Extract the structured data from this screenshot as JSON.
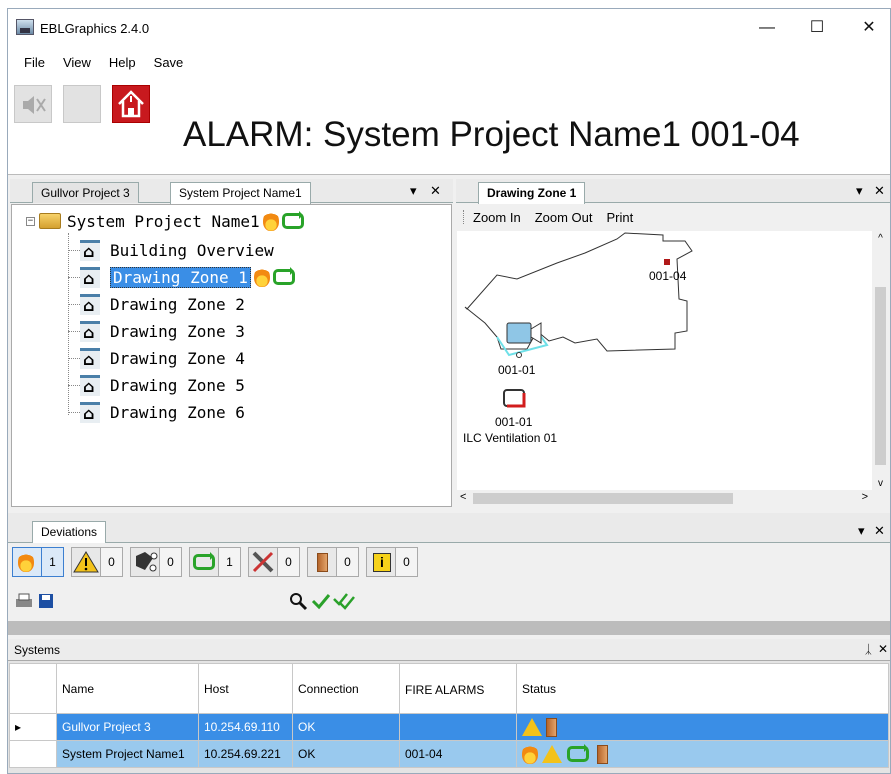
{
  "window": {
    "title": "EBLGraphics 2.4.0",
    "minimize_glyph": "—",
    "maximize_glyph": "☐",
    "close_glyph": "✕"
  },
  "menu": {
    "file": "File",
    "view": "View",
    "help": "Help",
    "save": "Save"
  },
  "alarm_banner": "ALARM: System Project Name1 001-04",
  "left_pane": {
    "tabs": [
      "Gullvor Project 3",
      "System Project Name1"
    ],
    "pin_glyph": "▾",
    "close_glyph": "✕",
    "tree": {
      "root": "System Project Name1",
      "nodes": [
        "Building Overview",
        "Drawing Zone 1",
        "Drawing Zone 2",
        "Drawing Zone 3",
        "Drawing Zone 4",
        "Drawing Zone 5",
        "Drawing Zone 6"
      ],
      "selected_node": "Drawing Zone 1"
    }
  },
  "right_pane": {
    "tab": "Drawing Zone 1",
    "toolbar": {
      "zoom_in": "Zoom In",
      "zoom_out": "Zoom Out",
      "print": "Print"
    },
    "labels": {
      "detector_top": "001-04",
      "camera_label": "001-01",
      "device_id": "001-01",
      "device_name": "ILC Ventilation 01"
    },
    "scroll_left": "<",
    "scroll_right": ">",
    "scroll_up": "^",
    "scroll_down": "v"
  },
  "deviations": {
    "tab": "Deviations",
    "counters": [
      {
        "icon": "fire-icon",
        "count": "1"
      },
      {
        "icon": "warning-icon",
        "count": "0"
      },
      {
        "icon": "network-icon",
        "count": "0"
      },
      {
        "icon": "refresh-icon",
        "count": "1"
      },
      {
        "icon": "tools-icon",
        "count": "0"
      },
      {
        "icon": "door-icon",
        "count": "0"
      },
      {
        "icon": "info-icon",
        "count": "0"
      }
    ]
  },
  "systems": {
    "title": "Systems",
    "pin_glyph": "ᛣ",
    "columns": [
      "Name",
      "Host",
      "Connection",
      "FIRE ALARMS",
      "Status"
    ],
    "rows": [
      {
        "name": "Gullvor Project 3",
        "host": "10.254.69.110",
        "connection": "OK",
        "fire_alarms": "",
        "status": [
          "warning-icon",
          "door-icon"
        ]
      },
      {
        "name": "System Project Name1",
        "host": "10.254.69.221",
        "connection": "OK",
        "fire_alarms": "001-04",
        "status": [
          "fire-icon",
          "warning-icon",
          "refresh-icon",
          "door-icon"
        ]
      }
    ]
  },
  "colors": {
    "selection": "#3a8ee6",
    "row_secondary": "#99c9ee",
    "alarm_red": "#c8191e",
    "ok_green": "#29a329"
  }
}
